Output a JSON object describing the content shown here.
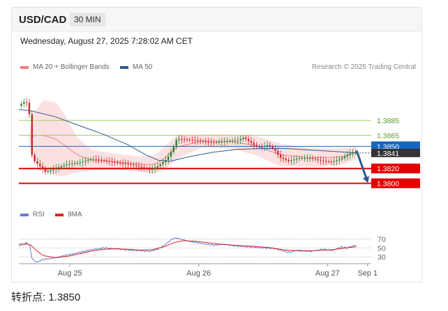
{
  "header": {
    "symbol": "USD/CAD",
    "timeframe": "30 MIN"
  },
  "timestamp": "Wednesday, August 27, 2025 7:28:02 AM CET",
  "legend": {
    "ma20": {
      "label": "MA 20 + Bollinger Bands",
      "color": "#f08080"
    },
    "ma50": {
      "label": "MA 50",
      "color": "#2e5a8f"
    }
  },
  "credit": "Research © 2025 Trading Central",
  "rsi_legend": {
    "rsi": {
      "label": "RSI",
      "color": "#5b7fd6"
    },
    "ma9": {
      "label": "9MA",
      "color": "#e02020"
    }
  },
  "footer": {
    "pivot_label": "转折点: 1.3850"
  },
  "colors": {
    "up": "#2e7d32",
    "down": "#c62828",
    "support": "#e00000",
    "resistance": "#9ccc65",
    "pivot": "#1565c0",
    "current": "#333333",
    "arrow": "#2e5a8f"
  },
  "chart_data": {
    "type": "candlestick",
    "title": "USD/CAD",
    "x_ticks": [
      "Aug 25",
      "Aug 26",
      "Aug 27",
      "Sep 1"
    ],
    "y_range": [
      1.3775,
      1.3935
    ],
    "current_price": 1.3841,
    "levels": [
      {
        "label": "1.3885",
        "value": 1.3885,
        "kind": "resistance"
      },
      {
        "label": "1.3865",
        "value": 1.3865,
        "kind": "resistance"
      },
      {
        "label": "1.3850",
        "value": 1.385,
        "kind": "pivot"
      },
      {
        "label": "1.3841",
        "value": 1.3841,
        "kind": "current"
      },
      {
        "label": "1.3820",
        "value": 1.382,
        "kind": "support"
      },
      {
        "label": "1.3800",
        "value": 1.38,
        "kind": "support"
      }
    ],
    "price_path": [
      [
        0,
        1.3905
      ],
      [
        4,
        1.391
      ],
      [
        8,
        1.3908
      ],
      [
        10,
        1.386
      ],
      [
        11,
        1.3833
      ],
      [
        16,
        1.3825
      ],
      [
        22,
        1.3815
      ],
      [
        30,
        1.382
      ],
      [
        40,
        1.3826
      ],
      [
        50,
        1.3828
      ],
      [
        60,
        1.3833
      ],
      [
        70,
        1.3831
      ],
      [
        80,
        1.3828
      ],
      [
        90,
        1.3826
      ],
      [
        100,
        1.3822
      ],
      [
        108,
        1.3818
      ],
      [
        115,
        1.3824
      ],
      [
        122,
        1.3833
      ],
      [
        127,
        1.3848
      ],
      [
        130,
        1.386
      ],
      [
        140,
        1.3859
      ],
      [
        150,
        1.3857
      ],
      [
        160,
        1.3855
      ],
      [
        170,
        1.3857
      ],
      [
        180,
        1.3858
      ],
      [
        185,
        1.3862
      ],
      [
        190,
        1.3856
      ],
      [
        195,
        1.385
      ],
      [
        200,
        1.3849
      ],
      [
        205,
        1.3852
      ],
      [
        210,
        1.3846
      ],
      [
        215,
        1.3835
      ],
      [
        222,
        1.383
      ],
      [
        230,
        1.3834
      ],
      [
        240,
        1.3834
      ],
      [
        250,
        1.383
      ],
      [
        258,
        1.3829
      ],
      [
        265,
        1.3833
      ],
      [
        272,
        1.384
      ],
      [
        278,
        1.3843
      ]
    ],
    "ma50_path": [
      [
        0,
        1.39
      ],
      [
        10,
        1.3898
      ],
      [
        30,
        1.389
      ],
      [
        50,
        1.3878
      ],
      [
        70,
        1.3866
      ],
      [
        90,
        1.3852
      ],
      [
        105,
        1.3838
      ],
      [
        115,
        1.3831
      ],
      [
        125,
        1.383
      ],
      [
        140,
        1.3836
      ],
      [
        160,
        1.3842
      ],
      [
        180,
        1.3846
      ],
      [
        200,
        1.3847
      ],
      [
        220,
        1.3847
      ],
      [
        240,
        1.3845
      ],
      [
        260,
        1.3843
      ],
      [
        278,
        1.3841
      ]
    ],
    "band_upper": [
      [
        8,
        1.386
      ],
      [
        12,
        1.3895
      ],
      [
        20,
        1.3912
      ],
      [
        30,
        1.391
      ],
      [
        38,
        1.3892
      ],
      [
        48,
        1.3862
      ],
      [
        60,
        1.3845
      ],
      [
        80,
        1.384
      ],
      [
        100,
        1.3836
      ],
      [
        112,
        1.3838
      ],
      [
        120,
        1.385
      ],
      [
        130,
        1.3865
      ],
      [
        150,
        1.3866
      ],
      [
        175,
        1.3866
      ],
      [
        195,
        1.3864
      ],
      [
        215,
        1.3854
      ],
      [
        240,
        1.3847
      ],
      [
        265,
        1.3847
      ],
      [
        278,
        1.385
      ]
    ],
    "band_lower": [
      [
        278,
        1.3833
      ],
      [
        265,
        1.3824
      ],
      [
        240,
        1.3822
      ],
      [
        215,
        1.3823
      ],
      [
        195,
        1.3838
      ],
      [
        175,
        1.3847
      ],
      [
        150,
        1.3848
      ],
      [
        130,
        1.3833
      ],
      [
        120,
        1.3818
      ],
      [
        112,
        1.3813
      ],
      [
        100,
        1.3815
      ],
      [
        80,
        1.3818
      ],
      [
        60,
        1.3817
      ],
      [
        48,
        1.3815
      ],
      [
        38,
        1.381
      ],
      [
        30,
        1.381
      ],
      [
        20,
        1.3818
      ],
      [
        12,
        1.3835
      ],
      [
        8,
        1.386
      ]
    ],
    "projection": {
      "from": 1.3844,
      "to": 1.3804
    },
    "rsi": {
      "levels": [
        70,
        50,
        30
      ],
      "y_range": [
        10,
        80
      ],
      "rsi_path": [
        [
          0,
          55
        ],
        [
          4,
          58
        ],
        [
          7,
          62
        ],
        [
          9,
          55
        ],
        [
          10,
          32
        ],
        [
          12,
          22
        ],
        [
          15,
          18
        ],
        [
          20,
          24
        ],
        [
          30,
          28
        ],
        [
          40,
          34
        ],
        [
          50,
          40
        ],
        [
          60,
          46
        ],
        [
          70,
          50
        ],
        [
          80,
          48
        ],
        [
          90,
          45
        ],
        [
          100,
          44
        ],
        [
          108,
          42
        ],
        [
          115,
          48
        ],
        [
          122,
          60
        ],
        [
          126,
          70
        ],
        [
          130,
          72
        ],
        [
          140,
          65
        ],
        [
          150,
          60
        ],
        [
          160,
          56
        ],
        [
          170,
          58
        ],
        [
          180,
          54
        ],
        [
          190,
          52
        ],
        [
          200,
          50
        ],
        [
          210,
          49
        ],
        [
          215,
          45
        ],
        [
          222,
          40
        ],
        [
          230,
          45
        ],
        [
          240,
          42
        ],
        [
          250,
          47
        ],
        [
          258,
          44
        ],
        [
          265,
          52
        ],
        [
          270,
          50
        ],
        [
          278,
          57
        ]
      ],
      "ma9_path": [
        [
          0,
          58
        ],
        [
          6,
          59
        ],
        [
          10,
          56
        ],
        [
          14,
          45
        ],
        [
          20,
          33
        ],
        [
          30,
          28
        ],
        [
          40,
          31
        ],
        [
          50,
          37
        ],
        [
          60,
          43
        ],
        [
          70,
          47
        ],
        [
          80,
          48
        ],
        [
          90,
          47
        ],
        [
          100,
          45
        ],
        [
          110,
          46
        ],
        [
          120,
          53
        ],
        [
          128,
          62
        ],
        [
          135,
          66
        ],
        [
          145,
          65
        ],
        [
          160,
          60
        ],
        [
          175,
          56
        ],
        [
          190,
          54
        ],
        [
          205,
          51
        ],
        [
          220,
          45
        ],
        [
          232,
          43
        ],
        [
          245,
          44
        ],
        [
          258,
          46
        ],
        [
          270,
          50
        ],
        [
          278,
          53
        ]
      ]
    }
  }
}
